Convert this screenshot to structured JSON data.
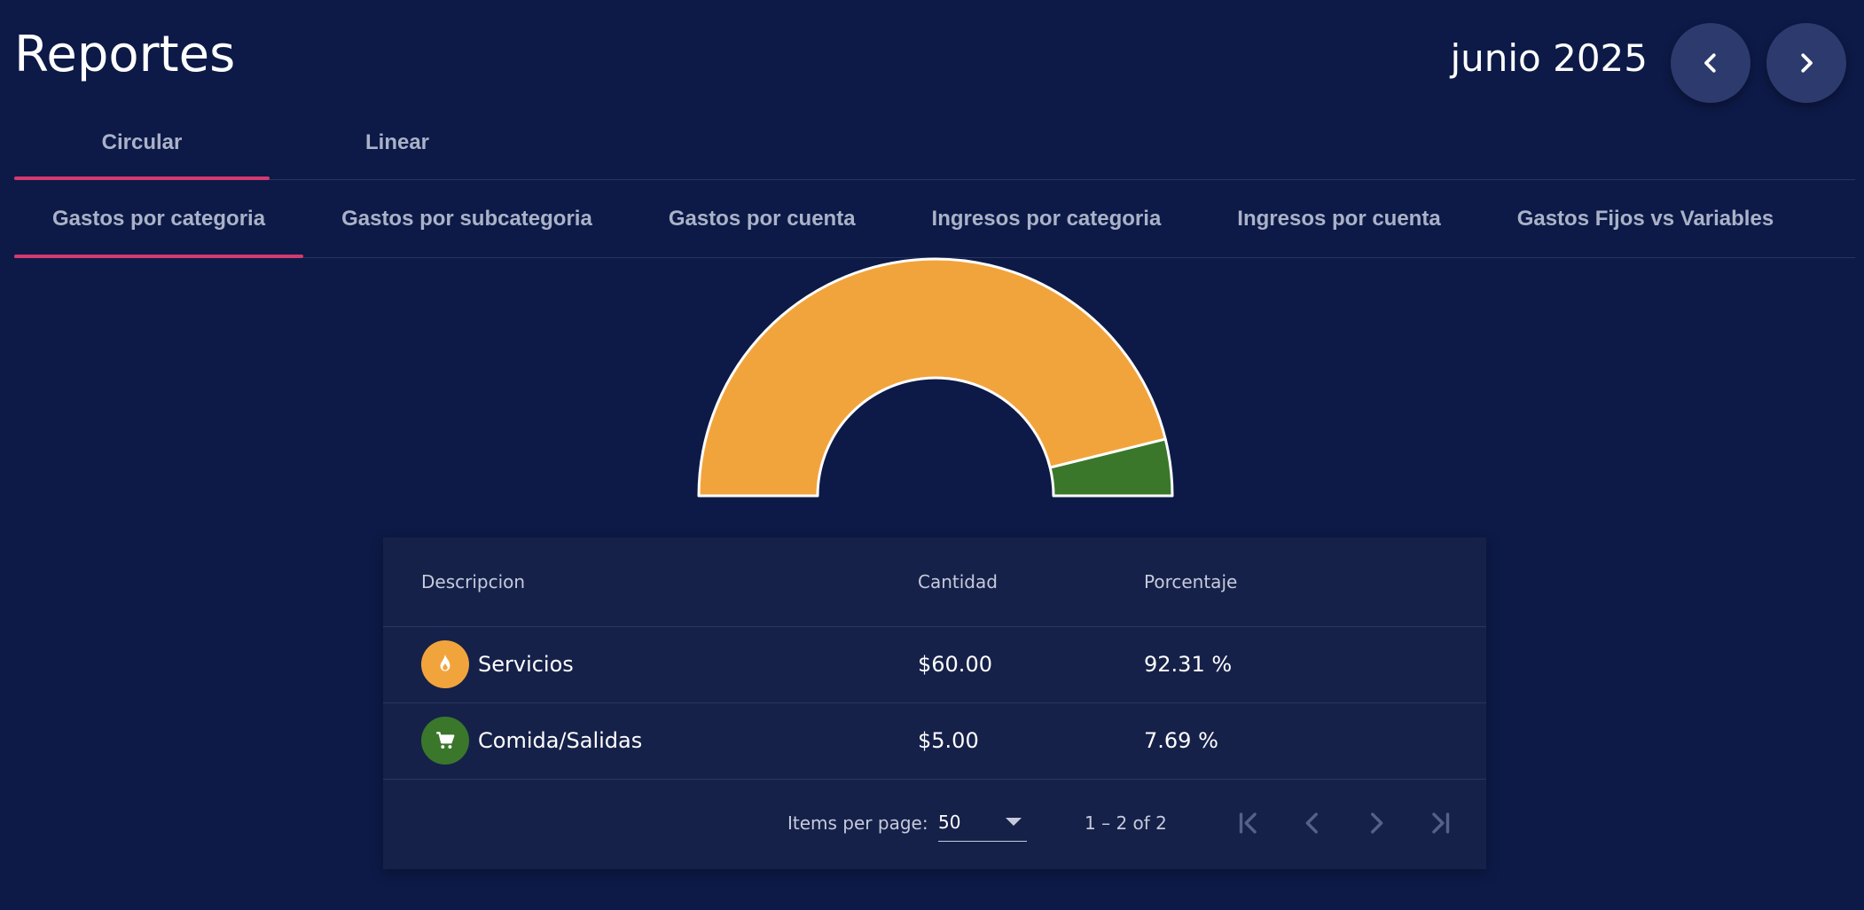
{
  "header": {
    "title": "Reportes",
    "period": "junio 2025",
    "prev_icon": "chevron-left-icon",
    "next_icon": "chevron-right-icon"
  },
  "chart_tabs": [
    {
      "label": "Circular",
      "active": true
    },
    {
      "label": "Linear",
      "active": false
    }
  ],
  "report_tabs": [
    {
      "label": "Gastos por categoria",
      "active": true
    },
    {
      "label": "Gastos por subcategoria",
      "active": false
    },
    {
      "label": "Gastos por cuenta",
      "active": false
    },
    {
      "label": "Ingresos por categoria",
      "active": false
    },
    {
      "label": "Ingresos por cuenta",
      "active": false
    },
    {
      "label": "Gastos Fijos vs Variables",
      "active": false
    }
  ],
  "colors": {
    "background": "#0d1a47",
    "accent": "#d43a6f",
    "servicios": "#f2a43c",
    "comida": "#3a772b"
  },
  "chart_data": {
    "type": "pie",
    "variant": "half-donut",
    "categories": [
      "Servicios",
      "Comida/Salidas"
    ],
    "values": [
      60,
      5
    ],
    "colors": [
      "#f2a43c",
      "#3a772b"
    ]
  },
  "table": {
    "columns": {
      "description": "Descripcion",
      "amount": "Cantidad",
      "percent": "Porcentaje"
    },
    "rows": [
      {
        "icon": "flame-icon",
        "description": "Servicios",
        "amount": "$60.00",
        "percent": "92.31 %"
      },
      {
        "icon": "cart-icon",
        "description": "Comida/Salidas",
        "amount": "$5.00",
        "percent": "7.69 %"
      }
    ]
  },
  "paginator": {
    "items_per_page_label": "Items per page:",
    "page_size": "50",
    "range_label": "1 – 2 of 2",
    "first_icon": "first-page-icon",
    "prev_icon": "chevron-left-icon",
    "next_icon": "chevron-right-icon",
    "last_icon": "last-page-icon"
  }
}
